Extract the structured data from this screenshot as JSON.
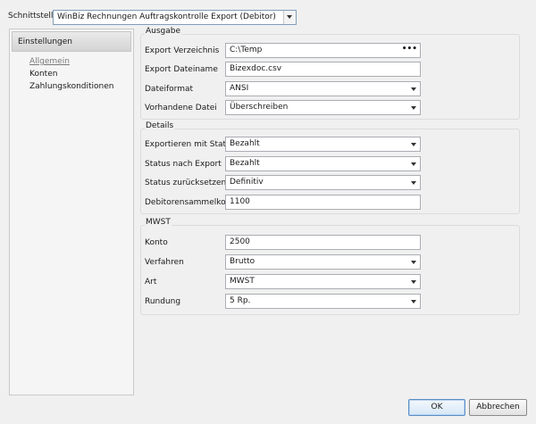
{
  "top": {
    "label": "Schnittstelle",
    "selected": "WinBiz Rechnungen Auftragskontrolle Export (Debitor)"
  },
  "sidebar": {
    "header": "Einstellungen",
    "items": [
      {
        "label": "Allgemein"
      },
      {
        "label": "Konten"
      },
      {
        "label": "Zahlungskonditionen"
      }
    ]
  },
  "ausgabe": {
    "title": "Ausgabe",
    "rows": [
      {
        "label": "Export Verzeichnis",
        "value": "C:\\Temp"
      },
      {
        "label": "Export Dateiname",
        "value": "Bizexdoc.csv"
      },
      {
        "label": "Dateiformat",
        "value": "ANSI"
      },
      {
        "label": "Vorhandene Datei",
        "value": "Überschreiben"
      }
    ],
    "browse_glyph": "•••"
  },
  "details": {
    "title": "Details",
    "rows": [
      {
        "label": "Exportieren mit Status",
        "value": "Bezahlt"
      },
      {
        "label": "Status nach Export",
        "value": "Bezahlt"
      },
      {
        "label": "Status zurücksetzen",
        "value": "Definitiv"
      },
      {
        "label": "Debitorensammelkonto",
        "value": "1100"
      }
    ]
  },
  "mwst": {
    "title": "MWST",
    "rows": [
      {
        "label": "Konto",
        "value": "2500"
      },
      {
        "label": "Verfahren",
        "value": "Brutto"
      },
      {
        "label": "Art",
        "value": "MWST"
      },
      {
        "label": "Rundung",
        "value": "5 Rp."
      }
    ]
  },
  "buttons": {
    "ok": "OK",
    "cancel": "Abbrechen"
  }
}
